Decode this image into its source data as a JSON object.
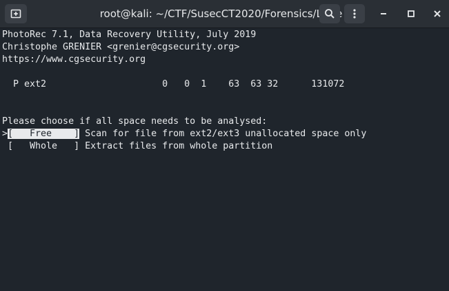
{
  "window": {
    "title": "root@kali: ~/CTF/SusecCT2020/Forensics/Little"
  },
  "icons": {
    "new_tab": "new-tab-icon",
    "search": "search-icon",
    "menu": "kebab-menu-icon",
    "minimize": "minimize-icon",
    "maximize": "maximize-icon",
    "close": "close-icon"
  },
  "terminal": {
    "header_line1": "PhotoRec 7.1, Data Recovery Utility, July 2019",
    "header_line2": "Christophe GRENIER <grenier@cgsecurity.org>",
    "header_line3": "https://www.cgsecurity.org",
    "partition_line": "  P ext2                     0   0  1    63  63 32      131072",
    "prompt": "Please choose if all space needs to be analysed:",
    "options": [
      {
        "cursor": ">",
        "label": "[   Free    ]",
        "description": " Scan for file from ext2/ext3 unallocated space only"
      },
      {
        "cursor": " ",
        "label": "[   Whole   ]",
        "description": " Extract files from whole partition"
      }
    ]
  },
  "colors": {
    "terminal_bg": "#1f252c",
    "titlebar_bg": "#2a2f35",
    "text": "#e8eaec"
  }
}
